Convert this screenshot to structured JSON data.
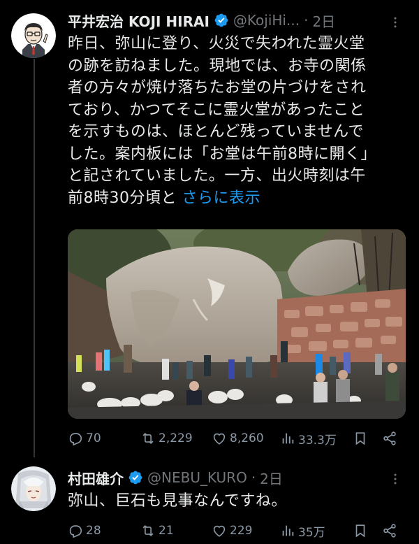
{
  "post1": {
    "author_name": "平井宏治 KOJI HIRAI",
    "handle": "@KojiHi...",
    "time": "2日",
    "body_lines": [
      "昨日、弥山に登り、火災で失われた霊火堂",
      "の跡を訪ねました。現地では、お寺の関係",
      "者の方々が焼け落ちたお堂の片づけをされ",
      "ており、かつてそこに霊火堂があったこと",
      "を示すものは、ほとんど残っていませんで",
      "した。案内板には「お堂は午前8時に開く」",
      "と記されていました。一方、出火時刻は午",
      "前8時30分頃と "
    ],
    "show_more": "さらに表示",
    "stats": {
      "replies": "70",
      "reposts": "2,229",
      "likes": "8,260",
      "views": "33.3万"
    }
  },
  "post2": {
    "author_name": "村田雄介",
    "handle": "@NEBU_KURO",
    "time": "2日",
    "body": "弥山、巨石も見事なんですね。",
    "stats": {
      "replies": "28",
      "reposts": "21",
      "likes": "229",
      "views": "35万"
    }
  },
  "colors": {
    "background": "#000000",
    "text": "#e7e9ea",
    "muted": "#71767b",
    "link": "#1d9bf0",
    "verified": "#1d9bf0"
  },
  "icons": {
    "reply": "reply-icon",
    "repost": "repost-icon",
    "like": "heart-icon",
    "views": "views-icon",
    "bookmark": "bookmark-icon",
    "share": "share-icon",
    "more": "more-icon",
    "verified": "verified-badge-icon"
  }
}
